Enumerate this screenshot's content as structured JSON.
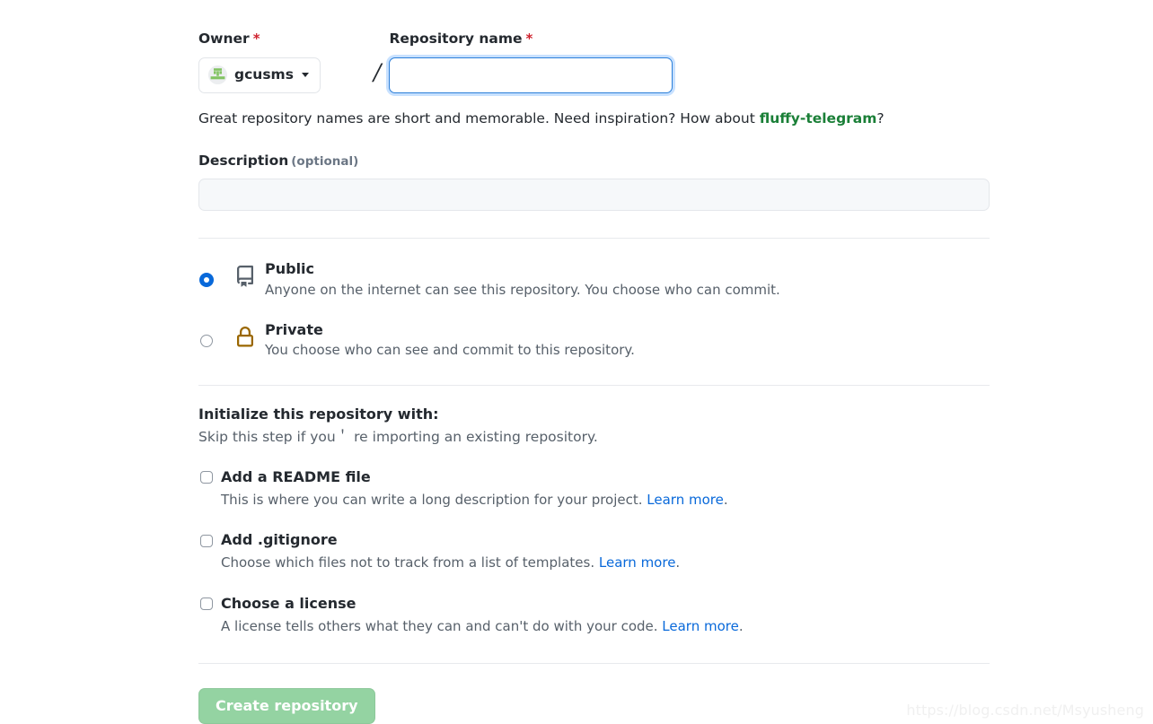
{
  "owner": {
    "label": "Owner",
    "required_mark": "*",
    "name": "gcusms",
    "avatar_icon": "user-avatar-identicon",
    "caret_icon": "chevron-down-icon"
  },
  "separator": "/",
  "repo_name": {
    "label": "Repository name",
    "required_mark": "*",
    "value": "",
    "placeholder": ""
  },
  "name_hint": {
    "before": "Great repository names are short and memorable. Need inspiration? How about ",
    "suggestion": "fluffy-telegram",
    "after": "?"
  },
  "description": {
    "label": "Description",
    "optional_label": "(optional)",
    "value": "",
    "placeholder": ""
  },
  "visibility": {
    "options": [
      {
        "id": "public",
        "title": "Public",
        "description": "Anyone on the internet can see this repository. You choose who can commit.",
        "icon": "repo-book-icon",
        "icon_color": "#57606a",
        "selected": true
      },
      {
        "id": "private",
        "title": "Private",
        "description": "You choose who can see and commit to this repository.",
        "icon": "lock-icon",
        "icon_color": "#9a6700",
        "selected": false
      }
    ]
  },
  "initialize": {
    "title": "Initialize this repository with:",
    "subtitle": "Skip this step if you＇ re importing an existing repository.",
    "items": [
      {
        "id": "readme",
        "label": "Add a README file",
        "description": "This is where you can write a long description for your project. ",
        "link_text": "Learn more",
        "description_end": ".",
        "checked": false
      },
      {
        "id": "gitignore",
        "label": "Add .gitignore",
        "description": "Choose which files not to track from a list of templates. ",
        "link_text": "Learn more",
        "description_end": ".",
        "checked": false
      },
      {
        "id": "license",
        "label": "Choose a license",
        "description": "A license tells others what they can and can't do with your code. ",
        "link_text": "Learn more",
        "description_end": ".",
        "checked": false
      }
    ]
  },
  "submit": {
    "label": "Create repository",
    "disabled": true,
    "color": "#94d3a2"
  },
  "watermark": "https://blog.csdn.net/Msyusheng",
  "colors": {
    "accent_blue": "#0969da",
    "focus_border": "#2b7fd9",
    "focus_ring": "#c8e1ff",
    "green_suggestion": "#1a7f37",
    "lock_gold": "#9a6700",
    "repo_gray": "#57606a",
    "muted_text": "#57606a",
    "divider": "#e8eaed"
  }
}
